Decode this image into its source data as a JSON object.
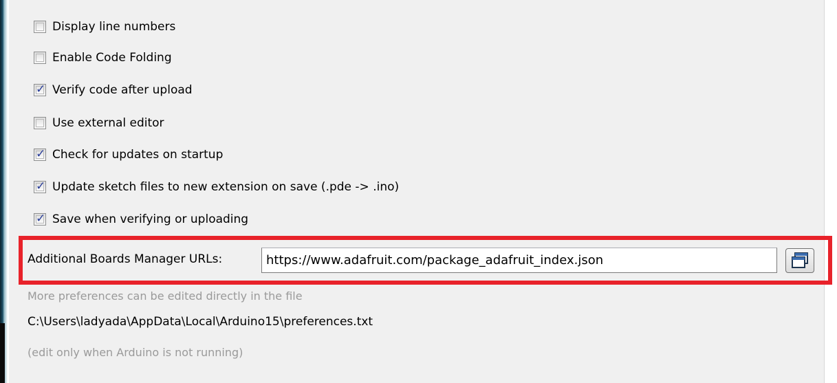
{
  "checkboxes": [
    {
      "label": "Display line numbers",
      "checked": false
    },
    {
      "label": "Enable Code Folding",
      "checked": false
    },
    {
      "label": "Verify code after upload",
      "checked": true
    },
    {
      "label": "Use external editor",
      "checked": false
    },
    {
      "label": "Check for updates on startup",
      "checked": true
    },
    {
      "label": "Update sketch files to new extension on save (.pde -> .ino)",
      "checked": true
    },
    {
      "label": "Save when verifying or uploading",
      "checked": true
    }
  ],
  "boards_manager": {
    "label": "Additional Boards Manager URLs:",
    "value": "https://www.adafruit.com/package_adafruit_index.json",
    "button_icon": "window-icon",
    "highlight_color": "#e8222a"
  },
  "footer": {
    "more_prefs": "More preferences can be edited directly in the file",
    "path": "C:\\Users\\ladyada\\AppData\\Local\\Arduino15\\preferences.txt",
    "note": "(edit only when Arduino is not running)"
  }
}
